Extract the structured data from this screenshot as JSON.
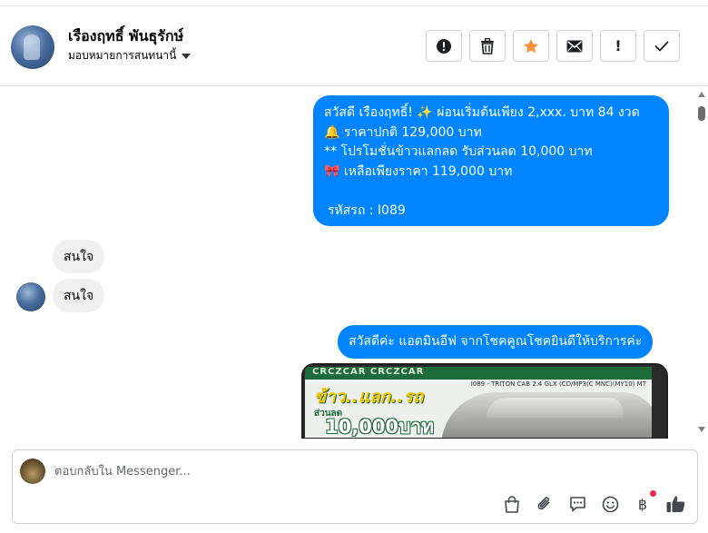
{
  "header": {
    "contact_name": "เรืองฤทธิ์ พันธุรักษ์",
    "assigned_label": "มอบหมายการสนทนานี้",
    "actions": [
      {
        "name": "report-button",
        "icon": "alert-circle-icon"
      },
      {
        "name": "delete-button",
        "icon": "trash-icon"
      },
      {
        "name": "star-button",
        "icon": "star-icon",
        "color": "#f7923a"
      },
      {
        "name": "mark-unread-button",
        "icon": "envelope-icon"
      },
      {
        "name": "follow-up-button",
        "icon": "exclamation-icon",
        "text": "!"
      },
      {
        "name": "done-button",
        "icon": "checkmark-icon"
      }
    ]
  },
  "messages": {
    "promo_lines": [
      "สวัสดี เรืองฤทธิ์! ✨  ผ่อนเริ่มต้นเพียง 2,xxx. บาท 84 งวด",
      "🔔 ราคาปกติ 129,000 บาท",
      "** โปรโมชั่นข้าวแลกลด รับส่วนลด 10,000 บาท",
      "🎀  เหลือเพียงราคา 119,000 บาท",
      "",
      "รหัสรถ : I089"
    ],
    "incoming_1": "สนใจ",
    "incoming_2": "สนใจ",
    "greeting": "สวัสดีค่ะ แอดมินอีฟ จากโชคคูณโชคยินดีให้บริการค่ะ",
    "image": {
      "banner": "CRCZCAR CRCZCAR",
      "model_text": "I089 - TRITON CAB 2.4 GLX (CD/MP3(C MNC)(MY10) MT",
      "headline": "ข้าว..แลก..รถ",
      "sub": "ส่วนลด",
      "amount": "10,000บาท"
    }
  },
  "composer": {
    "placeholder": "ตอบกลับใน Messenger...",
    "tools": [
      "shopping-bag-icon",
      "paperclip-icon",
      "saved-replies-icon",
      "emoji-icon",
      "baht-icon",
      "thumbs-up-icon"
    ],
    "baht_symbol": "฿"
  },
  "colors": {
    "outgoing_bubble": "#0084ff",
    "incoming_bubble": "#f0f0f0",
    "star": "#f7923a",
    "like": "#444950",
    "notification_dot": "#f02849"
  }
}
